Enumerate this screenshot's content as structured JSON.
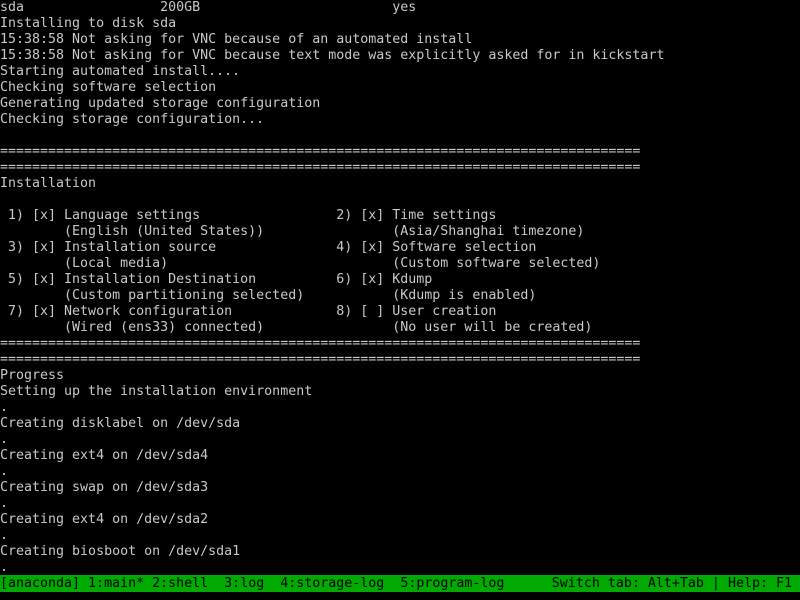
{
  "terminal": {
    "lines": [
      "sda                 200GB                        yes",
      "Installing to disk sda",
      "15:38:58 Not asking for VNC because of an automated install",
      "15:38:58 Not asking for VNC because text mode was explicitly asked for in kickstart",
      "Starting automated install....",
      "Checking software selection",
      "Generating updated storage configuration",
      "Checking storage configuration...",
      "",
      "================================================================================",
      "================================================================================",
      "Installation",
      "",
      " 1) [x] Language settings                 2) [x] Time settings",
      "        (English (United States))                (Asia/Shanghai timezone)",
      " 3) [x] Installation source               4) [x] Software selection",
      "        (Local media)                            (Custom software selected)",
      " 5) [x] Installation Destination          6) [x] Kdump",
      "        (Custom partitioning selected)           (Kdump is enabled)",
      " 7) [x] Network configuration             8) [ ] User creation",
      "        (Wired (ens33) connected)                (No user will be created)",
      "================================================================================",
      "================================================================================",
      "Progress",
      "Setting up the installation environment",
      ".",
      "Creating disklabel on /dev/sda",
      ".",
      "Creating ext4 on /dev/sda4",
      ".",
      "Creating swap on /dev/sda3",
      ".",
      "Creating ext4 on /dev/sda2",
      ".",
      "Creating biosboot on /dev/sda1",
      "."
    ]
  },
  "statusbar": {
    "tabs": [
      "[anaconda] 1:main*",
      " 2:shell ",
      " 3:log ",
      " 4:storage-log ",
      " 5:program-log"
    ],
    "switch_tab": "Switch tab: Alt+Tab",
    "separator": "|",
    "help": "Help: F1"
  },
  "colors": {
    "background": "#000000",
    "text": "#c8c8c8",
    "statusbar_bg": "#00aa00",
    "statusbar_text": "#000000"
  }
}
